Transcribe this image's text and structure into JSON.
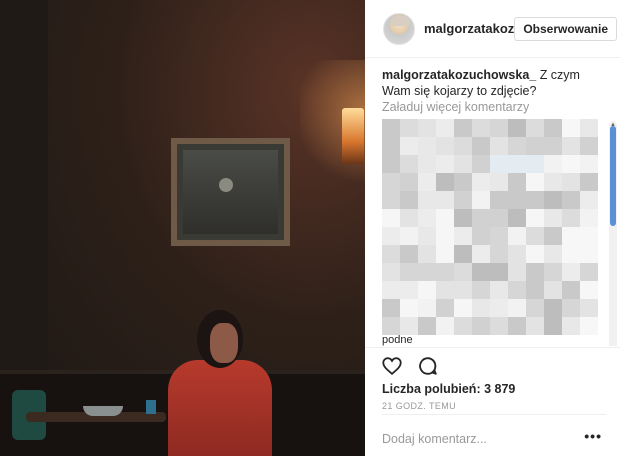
{
  "post": {
    "photo_icon": "photo"
  },
  "header": {
    "username": "malgorzatakoz",
    "follow_label": "Obserwowanie",
    "avatar_icon": "avatar-icon"
  },
  "caption": {
    "author": "malgorzatakozuchowska_",
    "text": " Z czym Wam się kojarzy to zdjęcie?"
  },
  "comments": {
    "load_more_label": "Załaduj więcej komentarzy",
    "blurred_fragment": "podne"
  },
  "actions": {
    "like_icon": "heart-icon",
    "comment_icon": "comment-icon",
    "likes_label": "Liczba polubień: 3 879",
    "timestamp": "21 GODZ. TEMU",
    "add_comment_placeholder": "Dodaj komentarz...",
    "more_label": "•••"
  },
  "colors": {
    "text": "#262626",
    "muted": "#999999",
    "border": "#dbdbdb",
    "scroll_thumb": "#5a90d6"
  }
}
